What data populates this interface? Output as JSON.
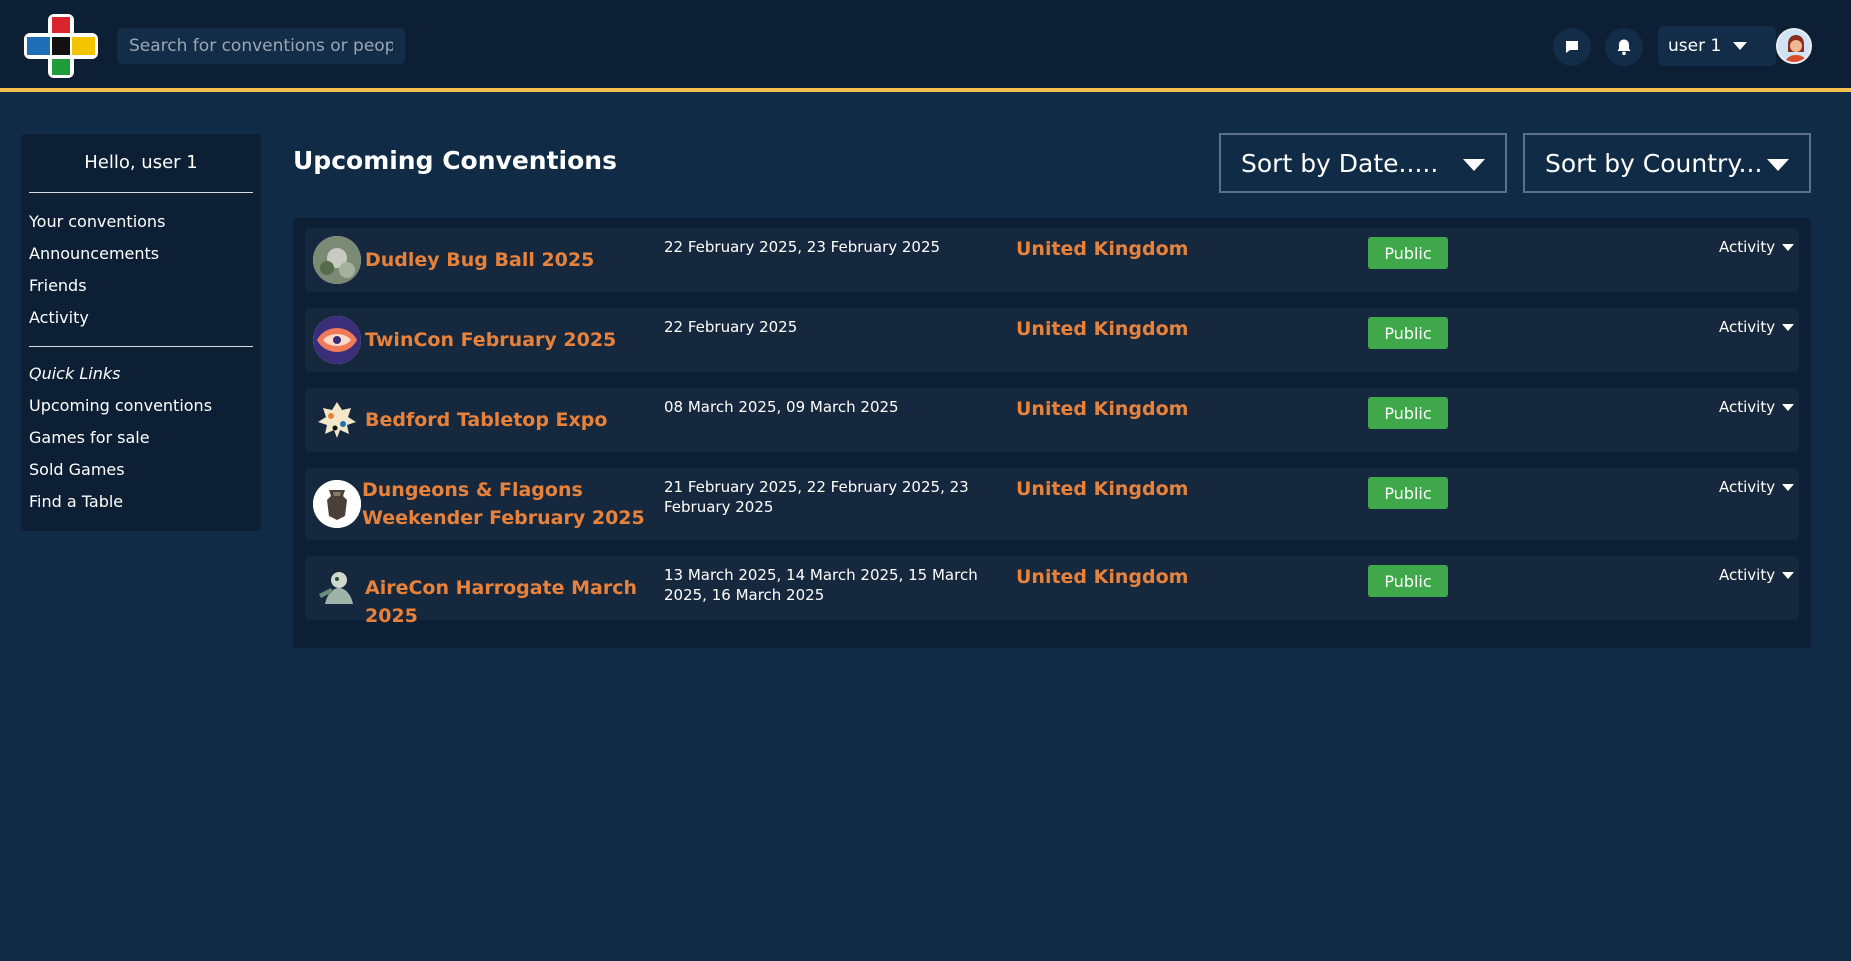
{
  "header": {
    "search_placeholder": "Search for conventions or people",
    "user_name": "user 1",
    "icons": [
      "logo-icon",
      "chat-icon",
      "bell-icon",
      "chevron-down-icon",
      "avatar"
    ]
  },
  "sidebar": {
    "greeting": "Hello, user 1",
    "links": [
      "Your conventions",
      "Announcements",
      "Friends",
      "Activity"
    ],
    "quick_links_heading": "Quick Links",
    "quick_links": [
      "Upcoming conventions",
      "Games for sale",
      "Sold Games",
      "Find a Table"
    ]
  },
  "main": {
    "title": "Upcoming Conventions",
    "sort_date_label": "Sort by Date.....",
    "sort_country_label": "Sort by Country...",
    "conventions": [
      {
        "name": "Dudley Bug Ball 2025",
        "dates": "22 February 2025, 23 February 2025",
        "country": "United Kingdom",
        "visibility": "Public",
        "activity": "Activity"
      },
      {
        "name": "TwinCon February 2025",
        "dates": "22 February 2025",
        "country": "United Kingdom",
        "visibility": "Public",
        "activity": "Activity"
      },
      {
        "name": "Bedford Tabletop Expo",
        "dates": "08 March 2025, 09 March 2025",
        "country": "United Kingdom",
        "visibility": "Public",
        "activity": "Activity"
      },
      {
        "name": "Dungeons & Flagons Weekender February 2025",
        "dates": "21 February 2025, 22 February 2025, 23 February 2025",
        "country": "United Kingdom",
        "visibility": "Public",
        "activity": "Activity"
      },
      {
        "name": "AireCon Harrogate March 2025",
        "dates": "13 March 2025, 14 March 2025, 15 March 2025, 16 March 2025",
        "country": "United Kingdom",
        "visibility": "Public",
        "activity": "Activity"
      }
    ]
  },
  "colors": {
    "page_bg": "#0f2b45",
    "header_bg": "#0c1f34",
    "accent_line": "#f2c04f",
    "link_orange": "#e8823b",
    "badge_green": "#3fa84a"
  }
}
